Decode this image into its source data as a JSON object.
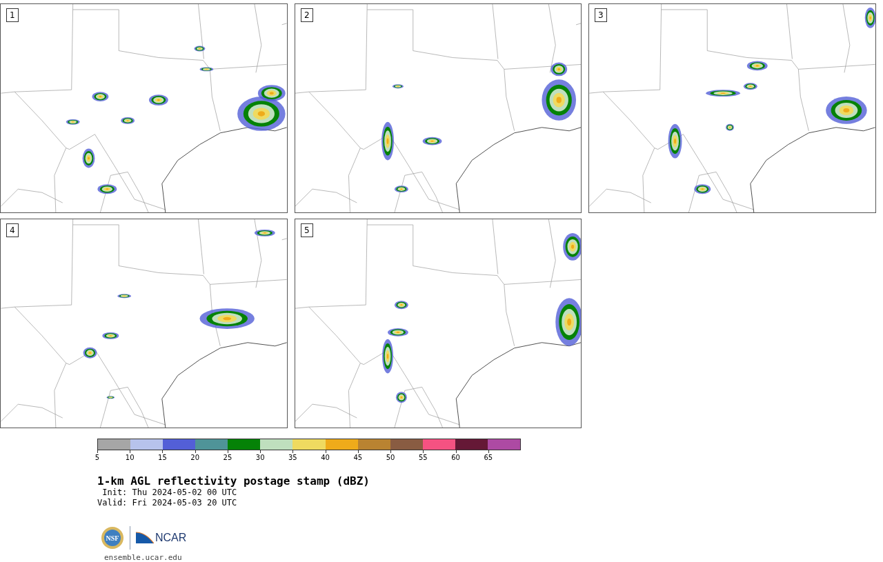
{
  "panels": [
    {
      "label": "1"
    },
    {
      "label": "2"
    },
    {
      "label": "3"
    },
    {
      "label": "4"
    },
    {
      "label": "5"
    }
  ],
  "colorbar": {
    "bins": [
      {
        "color": "#a6a6a6"
      },
      {
        "color": "#b7c3ec"
      },
      {
        "color": "#535fd7"
      },
      {
        "color": "#4f9498"
      },
      {
        "color": "#058207"
      },
      {
        "color": "#bfdfbe"
      },
      {
        "color": "#efda60"
      },
      {
        "color": "#efab1a"
      },
      {
        "color": "#b98331"
      },
      {
        "color": "#895c42"
      },
      {
        "color": "#f55282"
      },
      {
        "color": "#651836"
      },
      {
        "color": "#ad4aa3"
      }
    ],
    "ticks": [
      "5",
      "10",
      "15",
      "20",
      "25",
      "30",
      "35",
      "40",
      "45",
      "50",
      "55",
      "60",
      "65"
    ]
  },
  "title": "1-km AGL reflectivity postage stamp (dBZ)",
  "init": " Init: Thu 2024-05-02 00 UTC",
  "valid": "Valid: Fri 2024-05-03 20 UTC",
  "logos": {
    "nsf": "NSF",
    "ncar": "NCAR"
  },
  "footer": "ensemble.ucar.edu"
}
